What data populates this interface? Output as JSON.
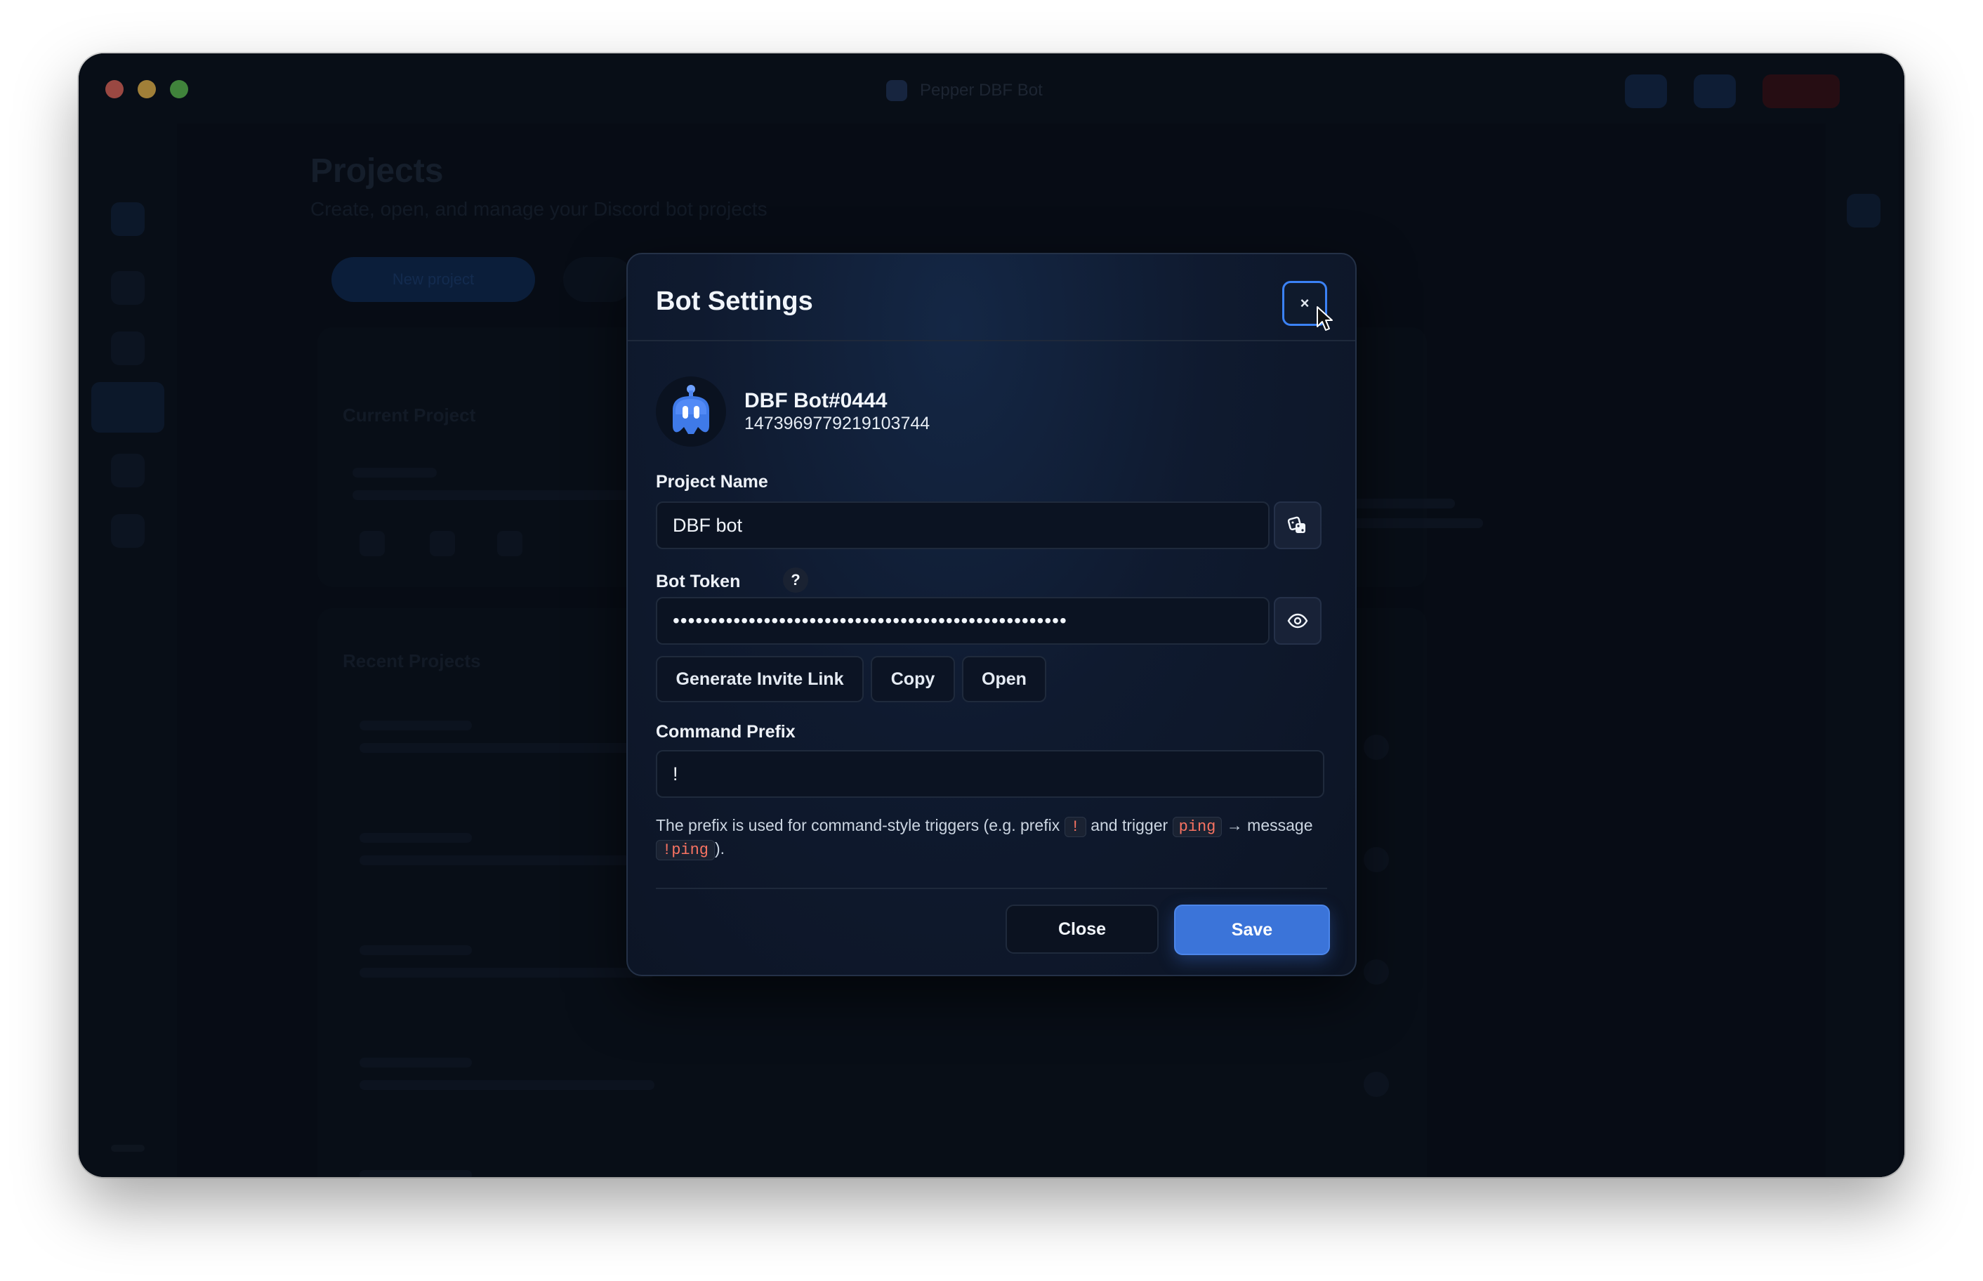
{
  "window": {
    "title": "Pepper DBF Bot"
  },
  "background": {
    "page_title": "Projects",
    "page_subtitle": "Create, open, and manage your Discord bot projects",
    "create_button": "New project",
    "card_a_label": "Current Project",
    "card_b_label": "Recent Projects"
  },
  "modal": {
    "title": "Bot Settings",
    "close_x": "×",
    "bot": {
      "name": "DBF Bot#0444",
      "id": "1473969779219103744"
    },
    "project_name": {
      "label": "Project Name",
      "value": "DBF bot"
    },
    "bot_token": {
      "label": "Bot Token",
      "help": "?",
      "masked_value": "••••••••••••••••••••••••••••••••••••••••••••••••••••"
    },
    "invite_buttons": {
      "generate": "Generate Invite Link",
      "copy": "Copy",
      "open": "Open"
    },
    "command_prefix": {
      "label": "Command Prefix",
      "value": "!"
    },
    "hint": {
      "part1": "The prefix is used for command-style triggers (e.g. prefix",
      "code_prefix": "!",
      "part2": "and trigger",
      "code_trigger": "ping",
      "arrow": "→",
      "part3": "message",
      "code_message": "!ping",
      "part4": ")."
    },
    "footer": {
      "close": "Close",
      "save": "Save"
    }
  },
  "colors": {
    "accent": "#3b74d9",
    "focus_ring": "#3b82f6",
    "code_text": "#f97362"
  },
  "icons": {
    "randomize": "dice-icon",
    "reveal": "eye-icon",
    "bot_avatar": "robot-icon"
  }
}
